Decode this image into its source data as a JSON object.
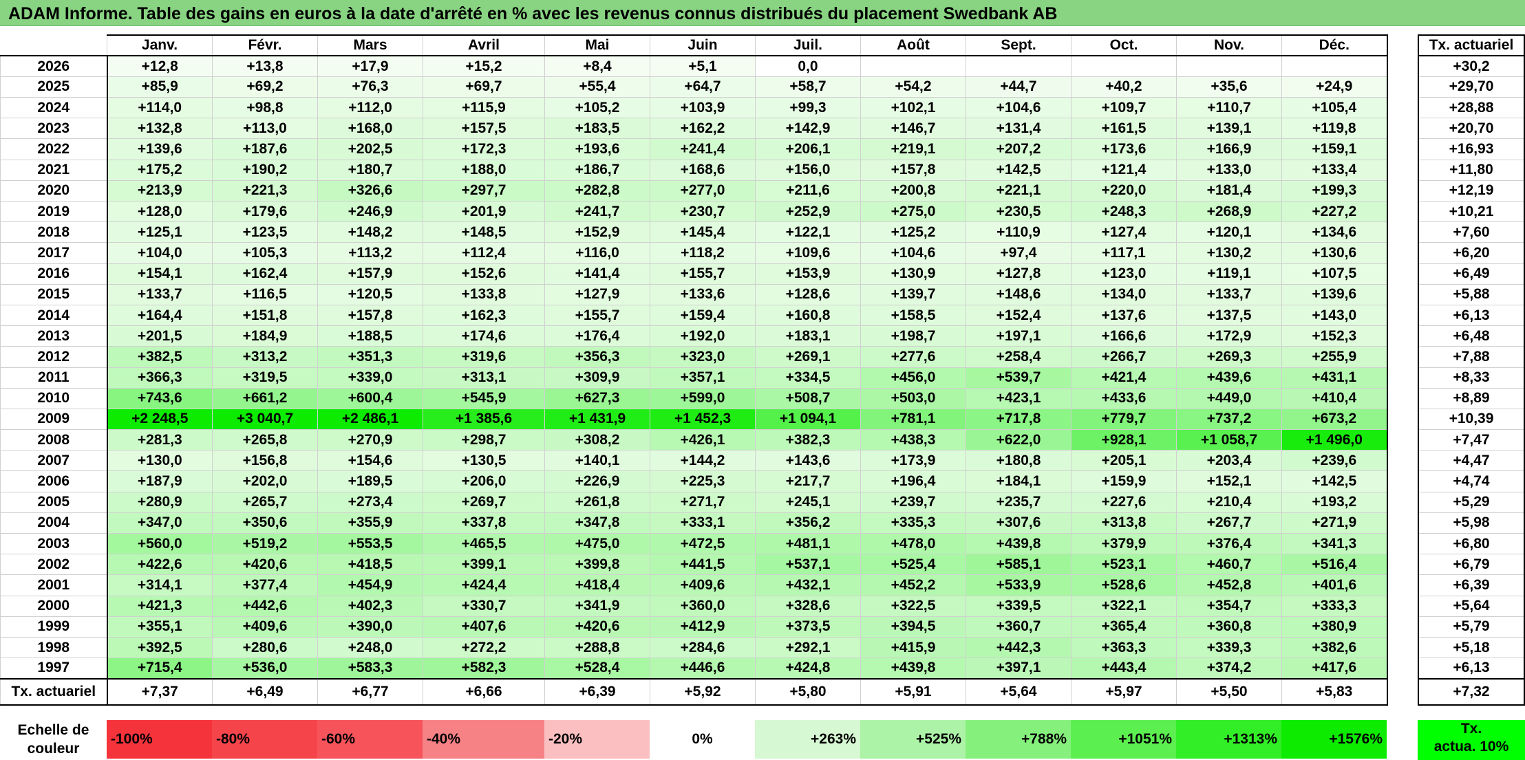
{
  "title": "ADAM Informe. Table des gains en euros à la date d'arrêté en % avec les revenus connus distribués du placement Swedbank AB",
  "months": [
    "Janv.",
    "Févr.",
    "Mars",
    "Avril",
    "Mai",
    "Juin",
    "Juil.",
    "Août",
    "Sept.",
    "Oct.",
    "Nov.",
    "Déc."
  ],
  "side_header": "Tx. actuariel",
  "rows": [
    {
      "year": "2026",
      "values": [
        "+12,8",
        "+13,8",
        "+17,9",
        "+15,2",
        "+8,4",
        "+5,1",
        "0,0",
        "",
        "",
        "",
        "",
        ""
      ],
      "tx": "+30,2"
    },
    {
      "year": "2025",
      "values": [
        "+85,9",
        "+69,2",
        "+76,3",
        "+69,7",
        "+55,4",
        "+64,7",
        "+58,7",
        "+54,2",
        "+44,7",
        "+40,2",
        "+35,6",
        "+24,9"
      ],
      "tx": "+29,70"
    },
    {
      "year": "2024",
      "values": [
        "+114,0",
        "+98,8",
        "+112,0",
        "+115,9",
        "+105,2",
        "+103,9",
        "+99,3",
        "+102,1",
        "+104,6",
        "+109,7",
        "+110,7",
        "+105,4"
      ],
      "tx": "+28,88"
    },
    {
      "year": "2023",
      "values": [
        "+132,8",
        "+113,0",
        "+168,0",
        "+157,5",
        "+183,5",
        "+162,2",
        "+142,9",
        "+146,7",
        "+131,4",
        "+161,5",
        "+139,1",
        "+119,8"
      ],
      "tx": "+20,70"
    },
    {
      "year": "2022",
      "values": [
        "+139,6",
        "+187,6",
        "+202,5",
        "+172,3",
        "+193,6",
        "+241,4",
        "+206,1",
        "+219,1",
        "+207,2",
        "+173,6",
        "+166,9",
        "+159,1"
      ],
      "tx": "+16,93"
    },
    {
      "year": "2021",
      "values": [
        "+175,2",
        "+190,2",
        "+180,7",
        "+188,0",
        "+186,7",
        "+168,6",
        "+156,0",
        "+157,8",
        "+142,5",
        "+121,4",
        "+133,0",
        "+133,4"
      ],
      "tx": "+11,80"
    },
    {
      "year": "2020",
      "values": [
        "+213,9",
        "+221,3",
        "+326,6",
        "+297,7",
        "+282,8",
        "+277,0",
        "+211,6",
        "+200,8",
        "+221,1",
        "+220,0",
        "+181,4",
        "+199,3"
      ],
      "tx": "+12,19"
    },
    {
      "year": "2019",
      "values": [
        "+128,0",
        "+179,6",
        "+246,9",
        "+201,9",
        "+241,7",
        "+230,7",
        "+252,9",
        "+275,0",
        "+230,5",
        "+248,3",
        "+268,9",
        "+227,2"
      ],
      "tx": "+10,21"
    },
    {
      "year": "2018",
      "values": [
        "+125,1",
        "+123,5",
        "+148,2",
        "+148,5",
        "+152,9",
        "+145,4",
        "+122,1",
        "+125,2",
        "+110,9",
        "+127,4",
        "+120,1",
        "+134,6"
      ],
      "tx": "+7,60"
    },
    {
      "year": "2017",
      "values": [
        "+104,0",
        "+105,3",
        "+113,2",
        "+112,4",
        "+116,0",
        "+118,2",
        "+109,6",
        "+104,6",
        "+97,4",
        "+117,1",
        "+130,2",
        "+130,6"
      ],
      "tx": "+6,20"
    },
    {
      "year": "2016",
      "values": [
        "+154,1",
        "+162,4",
        "+157,9",
        "+152,6",
        "+141,4",
        "+155,7",
        "+153,9",
        "+130,9",
        "+127,8",
        "+123,0",
        "+119,1",
        "+107,5"
      ],
      "tx": "+6,49"
    },
    {
      "year": "2015",
      "values": [
        "+133,7",
        "+116,5",
        "+120,5",
        "+133,8",
        "+127,9",
        "+133,6",
        "+128,6",
        "+139,7",
        "+148,6",
        "+134,0",
        "+133,7",
        "+139,6"
      ],
      "tx": "+5,88"
    },
    {
      "year": "2014",
      "values": [
        "+164,4",
        "+151,8",
        "+157,8",
        "+162,3",
        "+155,7",
        "+159,4",
        "+160,8",
        "+158,5",
        "+152,4",
        "+137,6",
        "+137,5",
        "+143,0"
      ],
      "tx": "+6,13"
    },
    {
      "year": "2013",
      "values": [
        "+201,5",
        "+184,9",
        "+188,5",
        "+174,6",
        "+176,4",
        "+192,0",
        "+183,1",
        "+198,7",
        "+197,1",
        "+166,6",
        "+172,9",
        "+152,3"
      ],
      "tx": "+6,48"
    },
    {
      "year": "2012",
      "values": [
        "+382,5",
        "+313,2",
        "+351,3",
        "+319,6",
        "+356,3",
        "+323,0",
        "+269,1",
        "+277,6",
        "+258,4",
        "+266,7",
        "+269,3",
        "+255,9"
      ],
      "tx": "+7,88"
    },
    {
      "year": "2011",
      "values": [
        "+366,3",
        "+319,5",
        "+339,0",
        "+313,1",
        "+309,9",
        "+357,1",
        "+334,5",
        "+456,0",
        "+539,7",
        "+421,4",
        "+439,6",
        "+431,1"
      ],
      "tx": "+8,33"
    },
    {
      "year": "2010",
      "values": [
        "+743,6",
        "+661,2",
        "+600,4",
        "+545,9",
        "+627,3",
        "+599,0",
        "+508,7",
        "+503,0",
        "+423,1",
        "+433,6",
        "+449,0",
        "+410,4"
      ],
      "tx": "+8,89"
    },
    {
      "year": "2009",
      "values": [
        "+2 248,5",
        "+3 040,7",
        "+2 486,1",
        "+1 385,6",
        "+1 431,9",
        "+1 452,3",
        "+1 094,1",
        "+781,1",
        "+717,8",
        "+779,7",
        "+737,2",
        "+673,2"
      ],
      "tx": "+10,39"
    },
    {
      "year": "2008",
      "values": [
        "+281,3",
        "+265,8",
        "+270,9",
        "+298,7",
        "+308,2",
        "+426,1",
        "+382,3",
        "+438,3",
        "+622,0",
        "+928,1",
        "+1 058,7",
        "+1 496,0"
      ],
      "tx": "+7,47"
    },
    {
      "year": "2007",
      "values": [
        "+130,0",
        "+156,8",
        "+154,6",
        "+130,5",
        "+140,1",
        "+144,2",
        "+143,6",
        "+173,9",
        "+180,8",
        "+205,1",
        "+203,4",
        "+239,6"
      ],
      "tx": "+4,47"
    },
    {
      "year": "2006",
      "values": [
        "+187,9",
        "+202,0",
        "+189,5",
        "+206,0",
        "+226,9",
        "+225,3",
        "+217,7",
        "+196,4",
        "+184,1",
        "+159,9",
        "+152,1",
        "+142,5"
      ],
      "tx": "+4,74"
    },
    {
      "year": "2005",
      "values": [
        "+280,9",
        "+265,7",
        "+273,4",
        "+269,7",
        "+261,8",
        "+271,7",
        "+245,1",
        "+239,7",
        "+235,7",
        "+227,6",
        "+210,4",
        "+193,2"
      ],
      "tx": "+5,29"
    },
    {
      "year": "2004",
      "values": [
        "+347,0",
        "+350,6",
        "+355,9",
        "+337,8",
        "+347,8",
        "+333,1",
        "+356,2",
        "+335,3",
        "+307,6",
        "+313,8",
        "+267,7",
        "+271,9"
      ],
      "tx": "+5,98"
    },
    {
      "year": "2003",
      "values": [
        "+560,0",
        "+519,2",
        "+553,5",
        "+465,5",
        "+475,0",
        "+472,5",
        "+481,1",
        "+478,0",
        "+439,8",
        "+379,9",
        "+376,4",
        "+341,3"
      ],
      "tx": "+6,80"
    },
    {
      "year": "2002",
      "values": [
        "+422,6",
        "+420,6",
        "+418,5",
        "+399,1",
        "+399,8",
        "+441,5",
        "+537,1",
        "+525,4",
        "+585,1",
        "+523,1",
        "+460,7",
        "+516,4"
      ],
      "tx": "+6,79"
    },
    {
      "year": "2001",
      "values": [
        "+314,1",
        "+377,4",
        "+454,9",
        "+424,4",
        "+418,4",
        "+409,6",
        "+432,1",
        "+452,2",
        "+533,9",
        "+528,6",
        "+452,8",
        "+401,6"
      ],
      "tx": "+6,39"
    },
    {
      "year": "2000",
      "values": [
        "+421,3",
        "+442,6",
        "+402,3",
        "+330,7",
        "+341,9",
        "+360,0",
        "+328,6",
        "+322,5",
        "+339,5",
        "+322,1",
        "+354,7",
        "+333,3"
      ],
      "tx": "+5,64"
    },
    {
      "year": "1999",
      "values": [
        "+355,1",
        "+409,6",
        "+390,0",
        "+407,6",
        "+420,6",
        "+412,9",
        "+373,5",
        "+394,5",
        "+360,7",
        "+365,4",
        "+360,8",
        "+380,9"
      ],
      "tx": "+5,79"
    },
    {
      "year": "1998",
      "values": [
        "+392,5",
        "+280,6",
        "+248,0",
        "+272,2",
        "+288,8",
        "+284,6",
        "+292,1",
        "+415,9",
        "+442,3",
        "+363,3",
        "+339,3",
        "+382,6"
      ],
      "tx": "+5,18"
    },
    {
      "year": "1997",
      "values": [
        "+715,4",
        "+536,0",
        "+583,3",
        "+582,3",
        "+528,4",
        "+446,6",
        "+424,8",
        "+439,8",
        "+397,1",
        "+443,4",
        "+374,2",
        "+417,6"
      ],
      "tx": "+6,13"
    }
  ],
  "footer": {
    "label": "Tx. actuariel",
    "values": [
      "+7,37",
      "+6,49",
      "+6,77",
      "+6,66",
      "+6,39",
      "+5,92",
      "+5,80",
      "+5,91",
      "+5,64",
      "+5,97",
      "+5,50",
      "+5,83"
    ],
    "tx": "+7,32"
  },
  "legend": {
    "label_line1": "Echelle de",
    "label_line2": "couleur",
    "items": [
      {
        "text": "-100%",
        "color": "#f5333b",
        "align": "l"
      },
      {
        "text": "-80%",
        "color": "#f5454b",
        "align": "l"
      },
      {
        "text": "-60%",
        "color": "#f6545a",
        "align": "l"
      },
      {
        "text": "-40%",
        "color": "#f78286",
        "align": "l"
      },
      {
        "text": "-20%",
        "color": "#fbbfc1",
        "align": "l"
      },
      {
        "text": "0%",
        "color": "#ffffff",
        "align": "c"
      },
      {
        "text": "+263%",
        "color": "#d6f8d2",
        "align": "r"
      },
      {
        "text": "+525%",
        "color": "#adf3a7",
        "align": "r"
      },
      {
        "text": "+788%",
        "color": "#86f07d",
        "align": "r"
      },
      {
        "text": "+1051%",
        "color": "#5cef50",
        "align": "r"
      },
      {
        "text": "+1313%",
        "color": "#32ee26",
        "align": "r"
      },
      {
        "text": "+1576%",
        "color": "#0ceb00",
        "align": "r"
      }
    ],
    "actua_line1": "Tx.",
    "actua_line2": "actua. 10%"
  }
}
